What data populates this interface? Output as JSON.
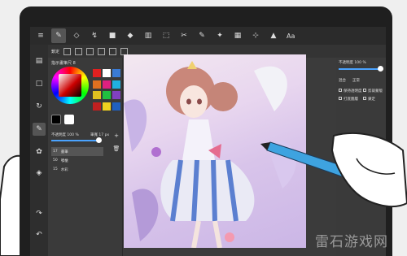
{
  "toolbar": {
    "items": [
      {
        "label": "≡",
        "name": "menu-icon"
      },
      {
        "label": "✎",
        "name": "pen-tool-icon"
      },
      {
        "label": "◇",
        "name": "eraser-icon"
      },
      {
        "label": "↯",
        "name": "blur-tool-icon"
      },
      {
        "label": "■",
        "name": "fill-rect-icon"
      },
      {
        "label": "◆",
        "name": "bucket-icon"
      },
      {
        "label": "▥",
        "name": "gradient-icon"
      },
      {
        "label": "⬚",
        "name": "select-rect-icon"
      },
      {
        "label": "✂",
        "name": "lasso-icon"
      },
      {
        "label": "✎",
        "name": "select-pen-icon"
      },
      {
        "label": "✦",
        "name": "magic-wand-icon"
      },
      {
        "label": "▦",
        "name": "layout-icon"
      },
      {
        "label": "⊹",
        "name": "move-icon"
      },
      {
        "label": "▲",
        "name": "pointer-icon"
      }
    ],
    "text_tool": "Aa"
  },
  "subbar": {
    "lock_label": "鎖定"
  },
  "color_panel": {
    "title": "指示畫筆尺 8",
    "opacity_label": "不透明度 100 %",
    "size_label": "筆寬 17 px",
    "opacity_value": 1.0,
    "brushes": [
      {
        "size": "17",
        "name": "書筆"
      },
      {
        "size": "50",
        "name": "噴槍"
      },
      {
        "size": "15",
        "name": "水彩"
      }
    ]
  },
  "right_panel": {
    "opacity_label": "不透明度 100 %",
    "blend_label": "混合",
    "blend_value": "正常",
    "checkboxes": [
      "保持透明度",
      "剪裁蒙版",
      "打底圖層",
      "鎖定"
    ],
    "layer_name": "圖層"
  },
  "watermark": "雷石游戏网",
  "colors": {
    "accent": "#4aa3ff",
    "palette": [
      "#e02020",
      "#ffffff",
      "#3a7bd5",
      "#e07020",
      "#e02080",
      "#20b0e0",
      "#e0c020",
      "#20c040",
      "#8040c0",
      "#c02020",
      "#f0d020",
      "#2060c0"
    ]
  }
}
